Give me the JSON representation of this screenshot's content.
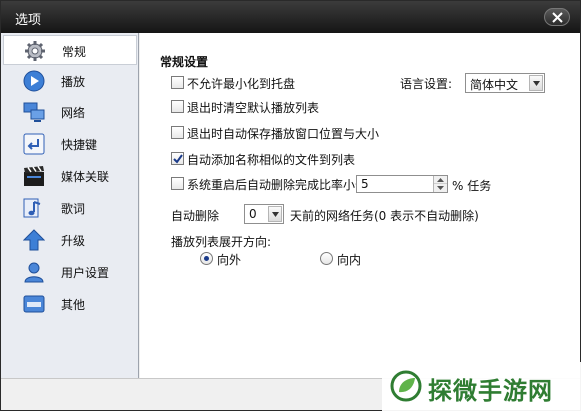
{
  "window": {
    "title": "选项"
  },
  "sidebar": {
    "items": [
      {
        "label": "常规",
        "icon": "gear-icon"
      },
      {
        "label": "播放",
        "icon": "play-icon"
      },
      {
        "label": "网络",
        "icon": "network-icon"
      },
      {
        "label": "快捷键",
        "icon": "enter-key-icon"
      },
      {
        "label": "媒体关联",
        "icon": "clapper-icon"
      },
      {
        "label": "歌词",
        "icon": "music-note-icon"
      },
      {
        "label": "升级",
        "icon": "up-arrow-icon"
      },
      {
        "label": "用户设置",
        "icon": "user-icon"
      },
      {
        "label": "其他",
        "icon": "etc-icon"
      }
    ],
    "selected": "常规"
  },
  "general": {
    "section_title": "常规设置",
    "options": {
      "minimize_tray": {
        "label": "不允许最小化到托盘",
        "checked": false
      },
      "clear_playlist": {
        "label": "退出时清空默认播放列表",
        "checked": false
      },
      "save_position": {
        "label": "退出时自动保存播放窗口位置与大小",
        "checked": false
      },
      "auto_add_similar": {
        "label": "自动添加名称相似的文件到列表",
        "checked": true
      },
      "auto_delete_on_restart": {
        "label": "系统重启后自动删除完成比率小于",
        "checked": false
      }
    },
    "language": {
      "label": "语言设置:",
      "value": "简体中文"
    },
    "ratio": {
      "value": "5",
      "suffix": "% 任务"
    },
    "auto_delete": {
      "prefix": "自动删除",
      "days_value": "0",
      "suffix": "天前的网络任务(0 表示不自动删除)"
    },
    "playlist_direction": {
      "label": "播放列表展开方向:",
      "options": [
        {
          "label": "向外",
          "selected": true
        },
        {
          "label": "向内",
          "selected": false
        }
      ]
    }
  },
  "watermark": {
    "text": "探微手游网"
  },
  "colors": {
    "titlebar": "#222222",
    "sidebar_bg": "#e9ecf2",
    "accent": "#1b3b8a",
    "watermark": "#2f7d32"
  }
}
